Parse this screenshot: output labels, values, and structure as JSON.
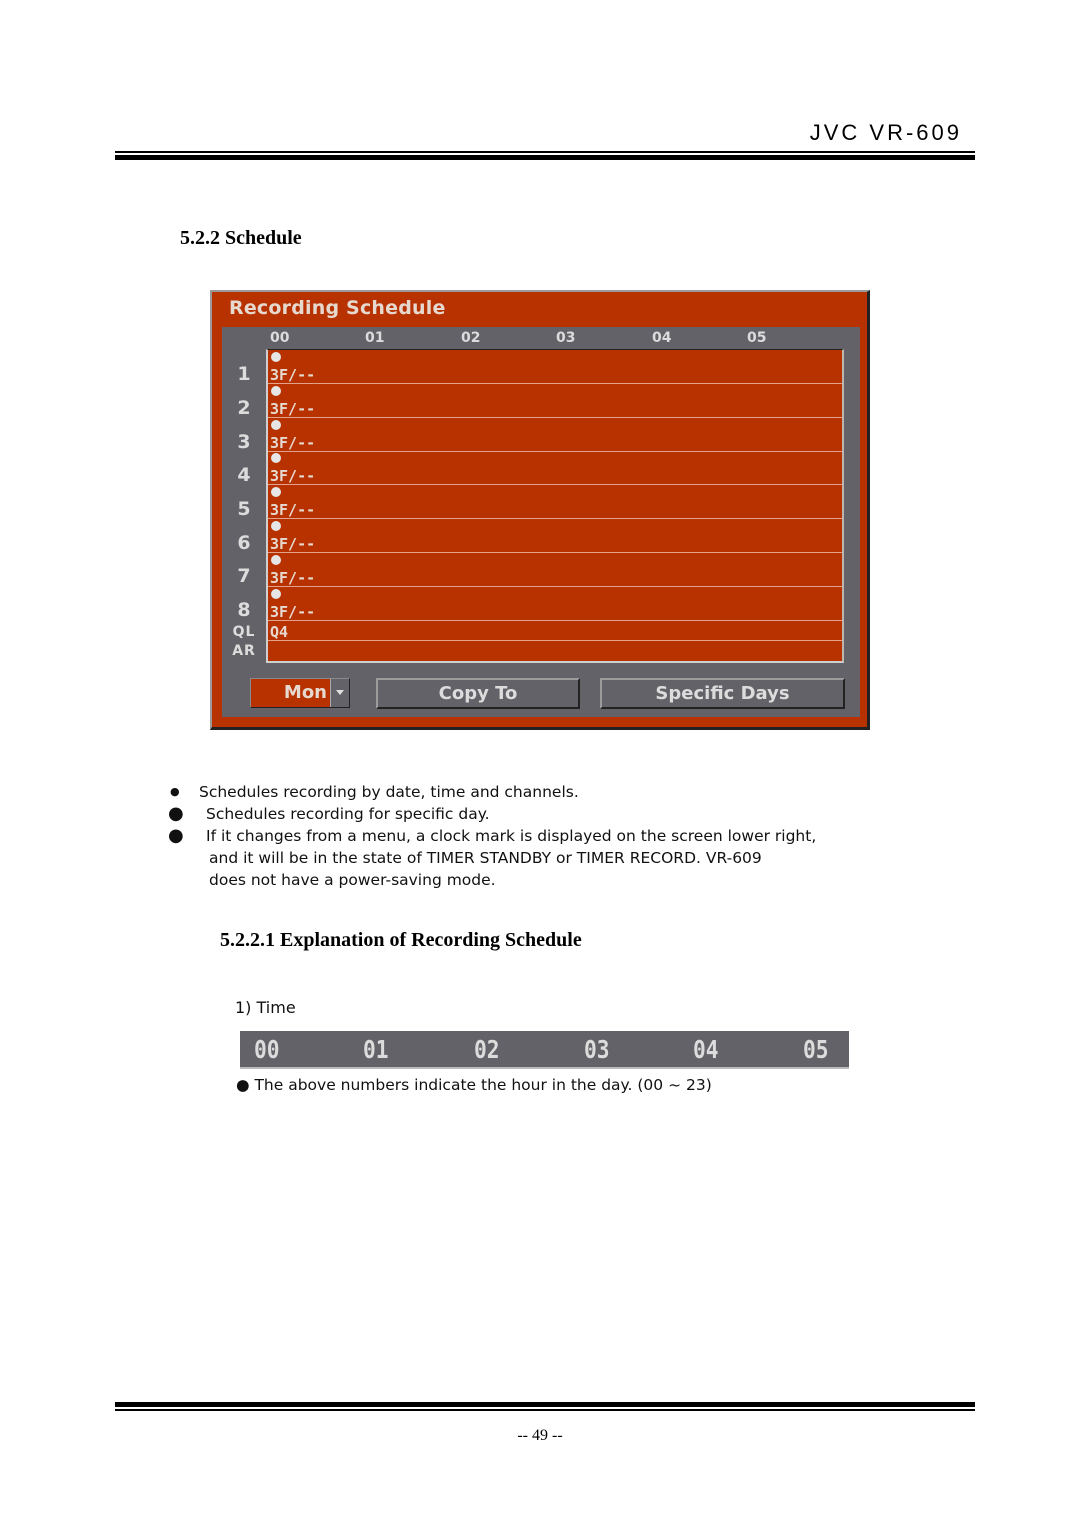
{
  "header": {
    "title": "JVC VR-609"
  },
  "section": {
    "title": "5.2.2 Schedule"
  },
  "panel": {
    "title": "Recording Schedule",
    "hours": [
      "00",
      "01",
      "02",
      "03",
      "04",
      "05"
    ],
    "channels": [
      {
        "label": "1",
        "value": "3F/--",
        "marked": true
      },
      {
        "label": "2",
        "value": "3F/--",
        "marked": true
      },
      {
        "label": "3",
        "value": "3F/--",
        "marked": true
      },
      {
        "label": "4",
        "value": "3F/--",
        "marked": true
      },
      {
        "label": "5",
        "value": "3F/--",
        "marked": true
      },
      {
        "label": "6",
        "value": "3F/--",
        "marked": true
      },
      {
        "label": "7",
        "value": "3F/--",
        "marked": true
      },
      {
        "label": "8",
        "value": "3F/--",
        "marked": true
      }
    ],
    "extra_rows": [
      {
        "label": "QL",
        "value": "Q4"
      },
      {
        "label": "AR",
        "value": ""
      }
    ],
    "day_select": {
      "value": "Mon"
    },
    "copy_to_label": "Copy To",
    "specific_days_label": "Specific Days",
    "colors": {
      "panel_red": "#b83200",
      "panel_gray": "#636268",
      "text_light": "#dcdcdc"
    }
  },
  "bullets": [
    {
      "mark": "●",
      "text": "Schedules recording by date, time and channels."
    },
    {
      "mark": "●",
      "text": "Schedules recording for specific day."
    },
    {
      "mark": "●",
      "text": "If it changes from a menu, a clock mark is displayed on the screen lower right,",
      "continuation": [
        "and it will be in the state of TIMER STANDBY or TIMER RECORD. VR-609",
        "does not have a power-saving mode."
      ]
    }
  ],
  "subsection": {
    "title": "5.2.2.1 Explanation of Recording Schedule"
  },
  "time_item": {
    "label": "1) Time",
    "hours": [
      "00",
      "01",
      "02",
      "03",
      "04",
      "05"
    ],
    "note": "● The above numbers indicate the hour in the day. (00 ~ 23)"
  },
  "footer": {
    "page": "-- 49 --"
  }
}
